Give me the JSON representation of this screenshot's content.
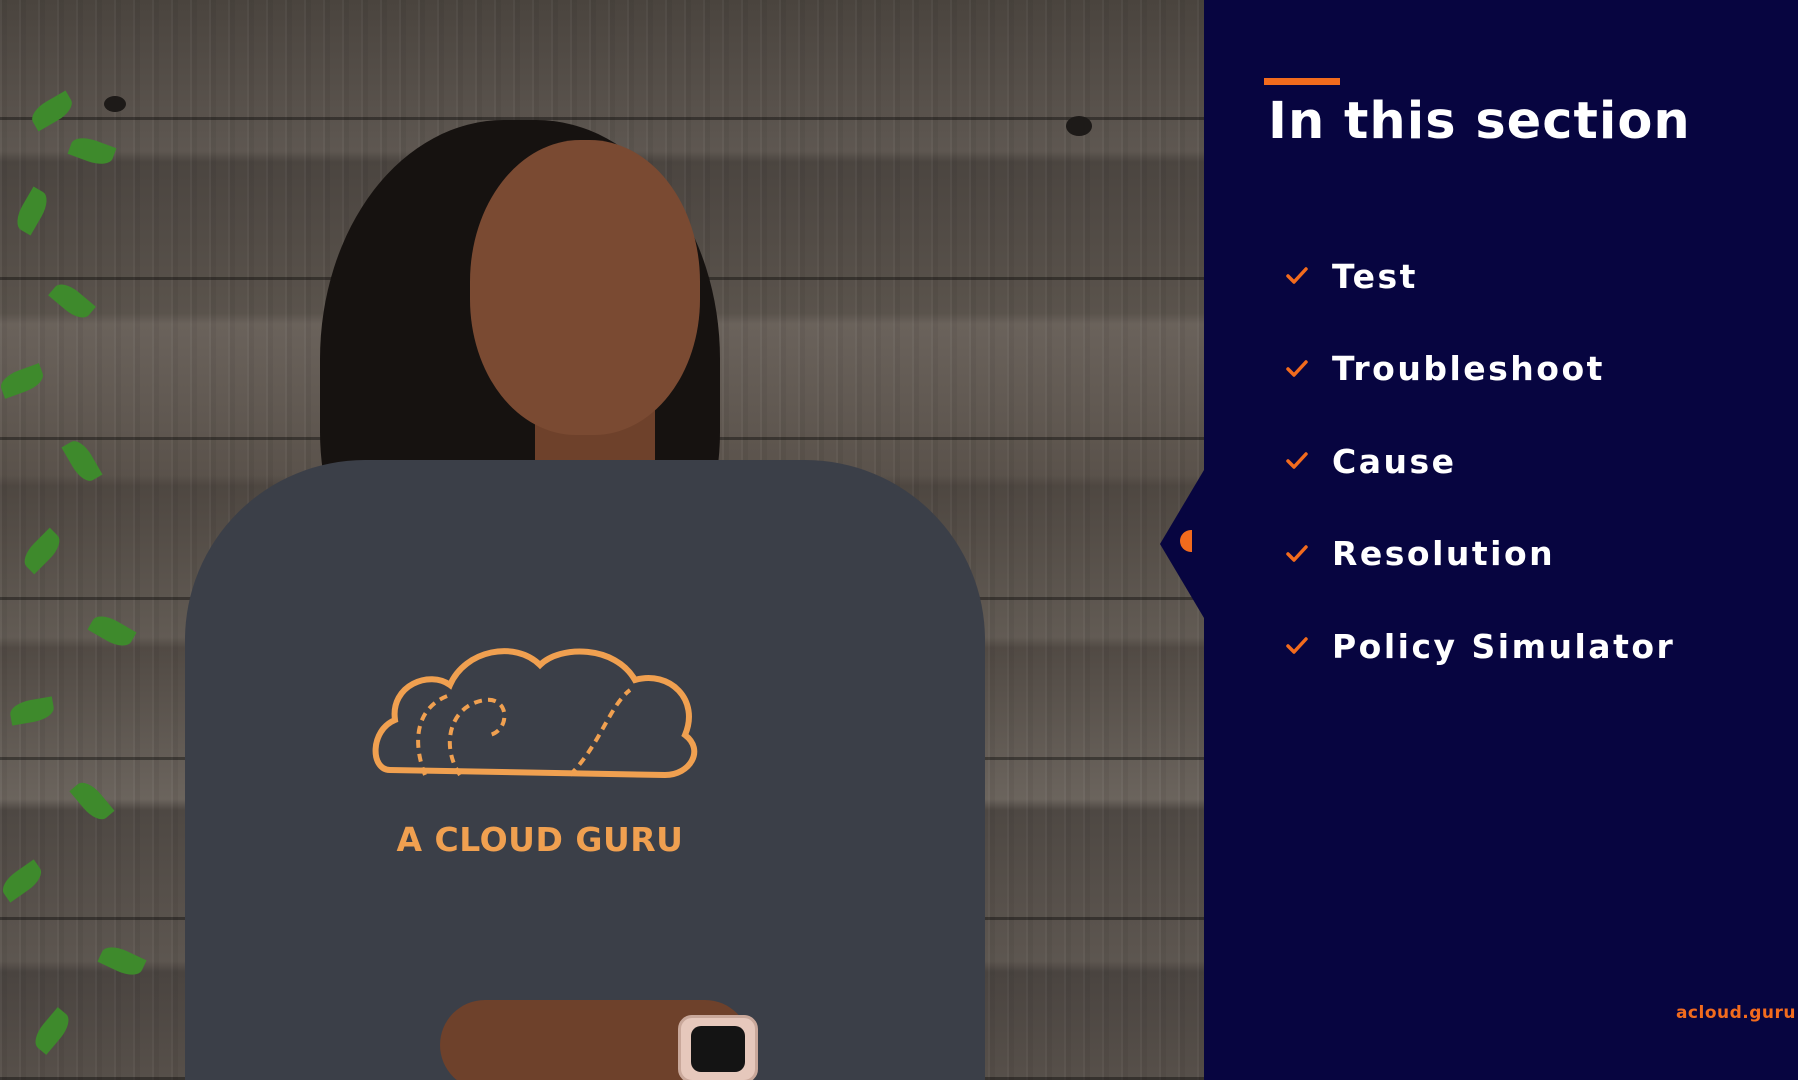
{
  "slide": {
    "title": "In this section",
    "topics": [
      {
        "label": "Test",
        "icon": "checkmark-icon"
      },
      {
        "label": "Troubleshoot",
        "icon": "checkmark-icon"
      },
      {
        "label": "Cause",
        "icon": "checkmark-icon"
      },
      {
        "label": "Resolution",
        "icon": "checkmark-icon"
      },
      {
        "label": "Policy Simulator",
        "icon": "checkmark-icon"
      }
    ],
    "brand": "acloud.guru"
  },
  "presenter": {
    "shirt_text": "A CLOUD GURU"
  },
  "colors": {
    "panel_background": "#070540",
    "accent": "#f26b1d",
    "text": "#ffffff",
    "shirt_print": "#f0a050"
  }
}
